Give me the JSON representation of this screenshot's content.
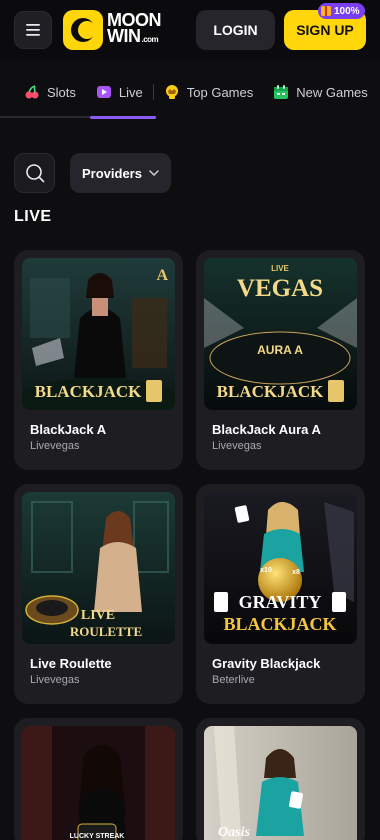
{
  "header": {
    "logo_line1": "MOON",
    "logo_line2": "WIN",
    "logo_suffix": ".com",
    "login_label": "LOGIN",
    "signup_label": "SIGN UP",
    "bonus_badge": "100%"
  },
  "tabs": [
    {
      "label": "Slots",
      "icon": "cherries-icon"
    },
    {
      "label": "Live",
      "icon": "play-icon",
      "active": true
    },
    {
      "label": "Top Games",
      "icon": "crown-icon"
    },
    {
      "label": "New Games",
      "icon": "calendar-icon"
    }
  ],
  "filters": {
    "providers_label": "Providers"
  },
  "section": {
    "title": "LIVE"
  },
  "games": [
    {
      "title": "BlackJack A",
      "provider": "Livevegas",
      "art_text": "BLACKJACK",
      "corner": "A"
    },
    {
      "title": "BlackJack Aura A",
      "provider": "Livevegas",
      "art_text": "BLACKJACK",
      "art_top": "LIVE",
      "art_brand": "VEGAS",
      "art_sub": "AURA A"
    },
    {
      "title": "Live Roulette",
      "provider": "Livevegas",
      "art_text_1": "LIVE",
      "art_text_2": "ROULETTE"
    },
    {
      "title": "Gravity Blackjack",
      "provider": "Beterlive",
      "art_text_1": "GRAVITY",
      "art_text_2": "BLACKJACK",
      "art_mult_1": "x10",
      "art_mult_2": "x8"
    },
    {
      "title": "",
      "provider": "",
      "art_text": "LUCKY STREAK"
    },
    {
      "title": "",
      "provider": "",
      "art_text": "Oasis"
    }
  ],
  "colors": {
    "accent_yellow": "#ffd60a",
    "accent_purple": "#8b5cf6",
    "card_bg": "#1d1d22",
    "page_bg": "#0e0e10"
  }
}
